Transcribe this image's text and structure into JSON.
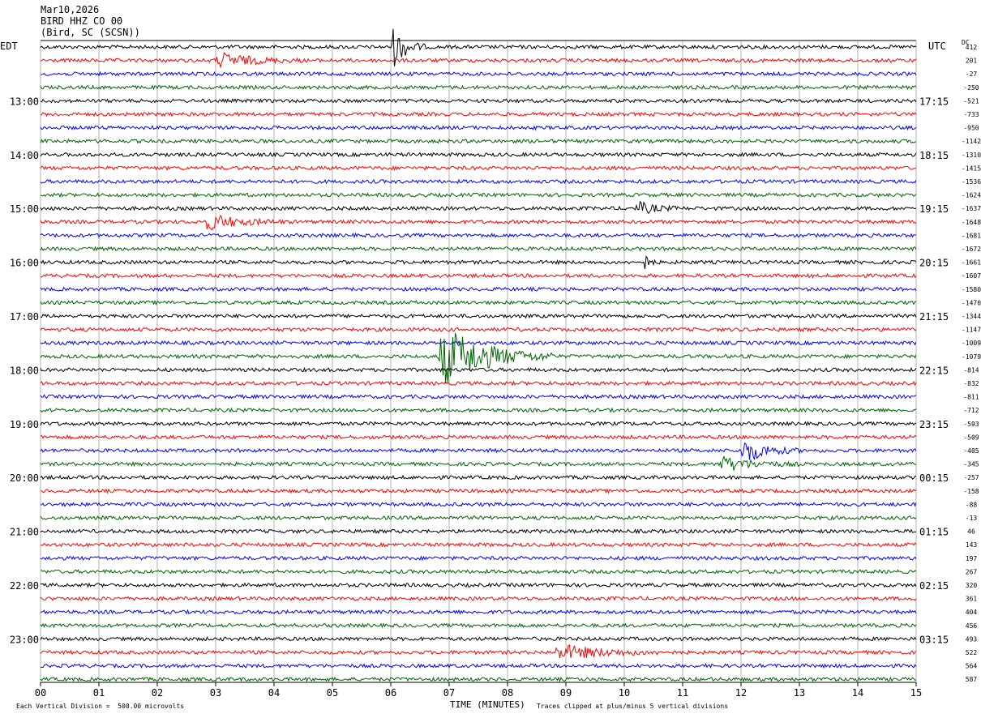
{
  "header": {
    "date": "Mar10,2026",
    "station": "BIRD HHZ CO 00",
    "location": "(Bird, SC (SCSN))"
  },
  "left_zone": "EDT",
  "right_zone": "UTC",
  "dc_label": "DC",
  "footer": {
    "scale": "Each Vertical Division =  500.00 microvolts",
    "clip": "Traces clipped at plus/minus 5 vertical divisions",
    "x_title": "TIME (MINUTES)"
  },
  "chart_data": {
    "type": "line",
    "title": "BIRD HHZ CO 00",
    "xlabel": "TIME (MINUTES)",
    "xlim": [
      0,
      15
    ],
    "x_ticks": [
      "00",
      "01",
      "02",
      "03",
      "04",
      "05",
      "06",
      "07",
      "08",
      "09",
      "10",
      "11",
      "12",
      "13",
      "14",
      "15"
    ],
    "trace_count": 48,
    "trace_colors": [
      "#000000",
      "#ff0000",
      "#0000ff",
      "#006400"
    ],
    "left_time_labels": [
      {
        "trace": 4,
        "label": "13:00"
      },
      {
        "trace": 8,
        "label": "14:00"
      },
      {
        "trace": 12,
        "label": "15:00"
      },
      {
        "trace": 16,
        "label": "16:00"
      },
      {
        "trace": 20,
        "label": "17:00"
      },
      {
        "trace": 24,
        "label": "18:00"
      },
      {
        "trace": 28,
        "label": "19:00"
      },
      {
        "trace": 32,
        "label": "20:00"
      },
      {
        "trace": 36,
        "label": "21:00"
      },
      {
        "trace": 40,
        "label": "22:00"
      },
      {
        "trace": 44,
        "label": "23:00"
      }
    ],
    "right_time_labels": [
      {
        "trace": 4,
        "label": "17:15"
      },
      {
        "trace": 8,
        "label": "18:15"
      },
      {
        "trace": 12,
        "label": "19:15"
      },
      {
        "trace": 16,
        "label": "20:15"
      },
      {
        "trace": 20,
        "label": "21:15"
      },
      {
        "trace": 24,
        "label": "22:15"
      },
      {
        "trace": 28,
        "label": "23:15"
      },
      {
        "trace": 32,
        "label": "00:15"
      },
      {
        "trace": 36,
        "label": "01:15"
      },
      {
        "trace": 40,
        "label": "02:15"
      },
      {
        "trace": 44,
        "label": "03:15"
      }
    ],
    "dc_offsets": [
      "412",
      "201",
      "-27",
      "-250",
      "-521",
      "-733",
      "-950",
      "-1142",
      "-1310",
      "-1415",
      "-1536",
      "-1624",
      "-1637",
      "-1648",
      "-1681",
      "-1672",
      "-1661",
      "-1607",
      "-1580",
      "-1470",
      "-1344",
      "-1147",
      "-1009",
      "-1079",
      "-814",
      "-832",
      "-811",
      "-712",
      "-593",
      "-509",
      "-405",
      "-345",
      "-257",
      "-158",
      "-88",
      "-13",
      "46",
      "143",
      "197",
      "267",
      "320",
      "361",
      "404",
      "456",
      "493",
      "522",
      "564",
      "587"
    ],
    "events": [
      {
        "trace": 0,
        "start_min": 6.0,
        "end_min": 6.6,
        "amplitude": 3.5
      },
      {
        "trace": 1,
        "start_min": 3.0,
        "end_min": 4.5,
        "amplitude": 1.2
      },
      {
        "trace": 12,
        "start_min": 10.2,
        "end_min": 11.0,
        "amplitude": 1.0
      },
      {
        "trace": 13,
        "start_min": 2.8,
        "end_min": 4.2,
        "amplitude": 1.3
      },
      {
        "trace": 16,
        "start_min": 10.3,
        "end_min": 10.6,
        "amplitude": 1.5
      },
      {
        "trace": 23,
        "start_min": 6.8,
        "end_min": 8.8,
        "amplitude": 5.0
      },
      {
        "trace": 30,
        "start_min": 12.0,
        "end_min": 13.0,
        "amplitude": 2.0
      },
      {
        "trace": 31,
        "start_min": 11.6,
        "end_min": 13.0,
        "amplitude": 1.2
      },
      {
        "trace": 45,
        "start_min": 8.8,
        "end_min": 10.8,
        "amplitude": 1.2
      }
    ]
  }
}
